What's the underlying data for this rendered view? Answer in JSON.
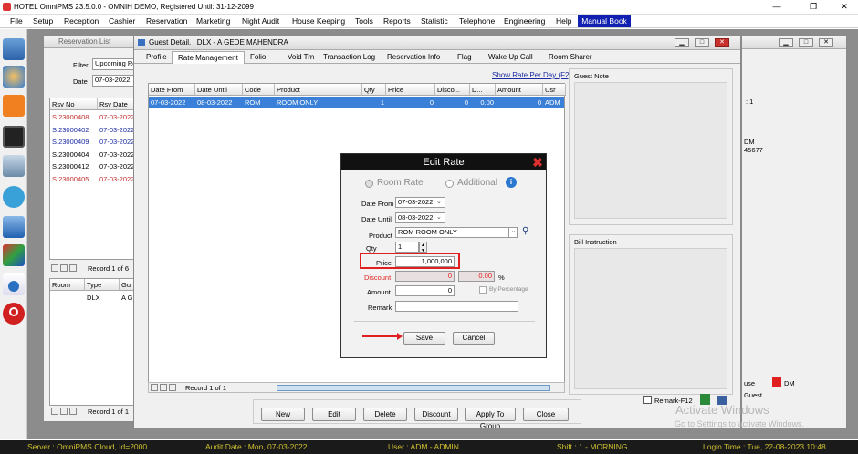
{
  "titlebar": {
    "title": "HOTEL OmniPMS 23.5.0.0 - OMNIH DEMO, Registered Until: 31-12-2099"
  },
  "menu": [
    "File",
    "Setup",
    "Reception",
    "Cashier",
    "Reservation",
    "Marketing",
    "Night Audit",
    "House Keeping",
    "Tools",
    "Reports",
    "Statistic",
    "Telephone",
    "Engineering",
    "Help"
  ],
  "manual_book": "Manual Book",
  "reservation_list": {
    "title": "Reservation List",
    "filter_label": "Filter",
    "filter_value": "Upcoming Re",
    "date_label": "Date",
    "date_value": "07-03-2022",
    "columns": [
      "Rsv No",
      "Rsv Date"
    ],
    "rows": [
      {
        "no": "S.23000408",
        "date": "07-03-2022",
        "color": "#c03030"
      },
      {
        "no": "S.23000402",
        "date": "07-03-2022",
        "color": "#1a2aa0"
      },
      {
        "no": "S.23000409",
        "date": "07-03-2022",
        "color": "#1a2aa0"
      },
      {
        "no": "S.23000404",
        "date": "07-03-2022",
        "color": "#000000"
      },
      {
        "no": "S.23000412",
        "date": "07-03-2022",
        "color": "#000000"
      },
      {
        "no": "S.23000405",
        "date": "07-03-2022",
        "color": "#c03030"
      }
    ],
    "record": "Record 1 of 6",
    "room_columns": [
      "Room",
      "Type",
      "Gu"
    ],
    "room_row": [
      "",
      "DLX",
      "A Gl"
    ],
    "record2": "Record 1 of 1"
  },
  "right_window": {
    "lines": [
      ": 1",
      "DM",
      "45677"
    ],
    "use_label": "use",
    "dm_label": "DM",
    "guest_label": "Guest"
  },
  "guest_detail": {
    "title": "Guest Detail.  | DLX - A GEDE MAHENDRA",
    "tabs": [
      "Profile",
      "Rate Management",
      "Folio",
      "Void Trn",
      "Transaction Log",
      "Reservation Info",
      "Flag",
      "Wake Up Call",
      "Room Sharer"
    ],
    "show_rate_link": "Show Rate Per Day (F2)",
    "columns": [
      "Date From",
      "Date Until",
      "Code",
      "Product",
      "Qty",
      "Price",
      "Disco...",
      "D...",
      "Amount",
      "Usr"
    ],
    "row": [
      "07-03-2022",
      "08-03-2022",
      "ROM",
      "ROOM ONLY",
      "1",
      "0",
      "0",
      "0.00",
      "0",
      "ADM"
    ],
    "record": "Record 1 of 1",
    "guest_note": "Guest Note",
    "bill_instruction": "Bill Instruction",
    "remark_label": "Remark-F12",
    "buttons": [
      "New",
      "Edit",
      "Delete",
      "Discount",
      "Apply To Group",
      "Close"
    ]
  },
  "edit_rate": {
    "title": "Edit Rate",
    "room_rate": "Room Rate",
    "additional": "Additional",
    "date_from_label": "Date From",
    "date_from": "07-03-2022",
    "date_until_label": "Date Until",
    "date_until": "08-03-2022",
    "product_label": "Product",
    "product": "ROM ROOM ONLY",
    "qty_label": "Qty",
    "qty": "1",
    "price_label": "Price",
    "price": "1,000,000",
    "discount_label": "Discount",
    "discount": "0",
    "discount_pct": "0.00",
    "pct_sign": "%",
    "amount_label": "Amount",
    "amount": "0",
    "by_percentage": "By Percentage",
    "remark_label": "Remark",
    "remark": "",
    "save": "Save",
    "cancel": "Cancel"
  },
  "watermark": {
    "line1": "Activate Windows",
    "line2": "Go to Settings to activate Windows."
  },
  "status": {
    "server": "Server : OmniPMS Cloud, Id=2000",
    "audit": "Audit Date : Mon, 07-03-2022",
    "user": "User : ADM - ADMIN",
    "shift": "Shift : 1 - MORNING",
    "login": "Login Time : Tue, 22-08-2023 10:48"
  },
  "colors": {
    "highlight": "#e02020",
    "selection": "#3a80d8",
    "status_text": "#d0c030"
  }
}
